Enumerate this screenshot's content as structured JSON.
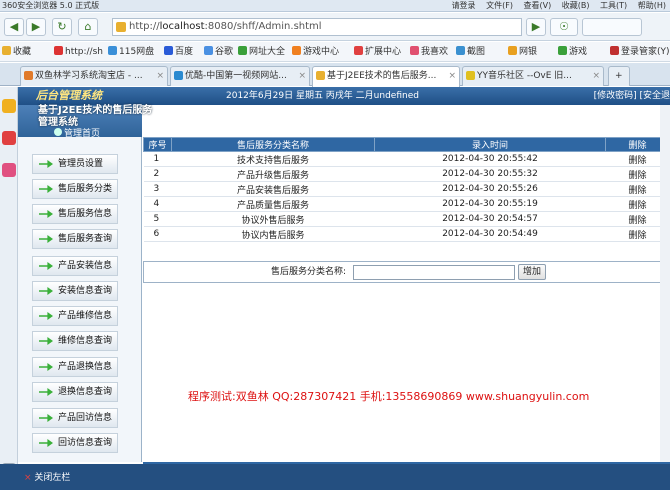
{
  "browser": {
    "title": "360安全浏览器 5.0 正式版",
    "title_menu": [
      "请登录",
      "文件(F)",
      "查看(V)",
      "收藏(B)",
      "工具(T)",
      "帮助(H)"
    ],
    "url_host": "localhost",
    "url_rest": ":8080/shff/Admin.shtml",
    "url_prefix": "http://",
    "bookmarks": [
      "收藏",
      "http://sh",
      "115网盘",
      "百度",
      "谷歌",
      "网址大全",
      "游戏中心",
      "扩展中心",
      "我喜欢",
      "截图",
      "网银",
      "游戏",
      "登录管家(Y)"
    ],
    "tabs": [
      {
        "label": "双鱼林学习系统淘宝店 - ...",
        "active": false
      },
      {
        "label": "优酷-中国第一视频网站...",
        "active": false
      },
      {
        "label": "基于J2EE技术的售后服务...",
        "active": true
      },
      {
        "label": "YY音乐社区 --OvE 旧...",
        "active": false
      }
    ]
  },
  "app": {
    "logo": "后台管理系统",
    "subtitle": "基于J2EE技术的售后服务管理系统",
    "mgmt_home": "管理首页",
    "date": "2012年6月29日 星期五 丙戌年 二月undefined",
    "top_links": "[修改密码] [安全退",
    "menu": [
      "管理员设置",
      "售后服务分类",
      "售后服务信息",
      "售后服务查询",
      "产品安装信息",
      "安装信息查询",
      "产品维修信息",
      "维修信息查询",
      "产品退换信息",
      "退换信息查询",
      "产品回访信息",
      "回访信息查询"
    ],
    "table": {
      "headers": [
        "序号",
        "售后服务分类名称",
        "录入时间",
        "删除"
      ],
      "rows": [
        [
          "1",
          "技术支持售后服务",
          "2012-04-30 20:55:42",
          "删除"
        ],
        [
          "2",
          "产品升级售后服务",
          "2012-04-30 20:55:32",
          "删除"
        ],
        [
          "3",
          "产品安装售后服务",
          "2012-04-30 20:55:26",
          "删除"
        ],
        [
          "4",
          "产品质量售后服务",
          "2012-04-30 20:55:19",
          "删除"
        ],
        [
          "5",
          "协议外售后服务",
          "2012-04-30 20:54:57",
          "删除"
        ],
        [
          "6",
          "协议内售后服务",
          "2012-04-30 20:54:49",
          "删除"
        ]
      ]
    },
    "form": {
      "label": "售后服务分类名称:",
      "value": "",
      "button": "增加"
    },
    "note": "程序测试:双鱼林 QQ:287307421 手机:13558690869 www.shuangyulin.com",
    "close_left": "关闭左栏"
  }
}
